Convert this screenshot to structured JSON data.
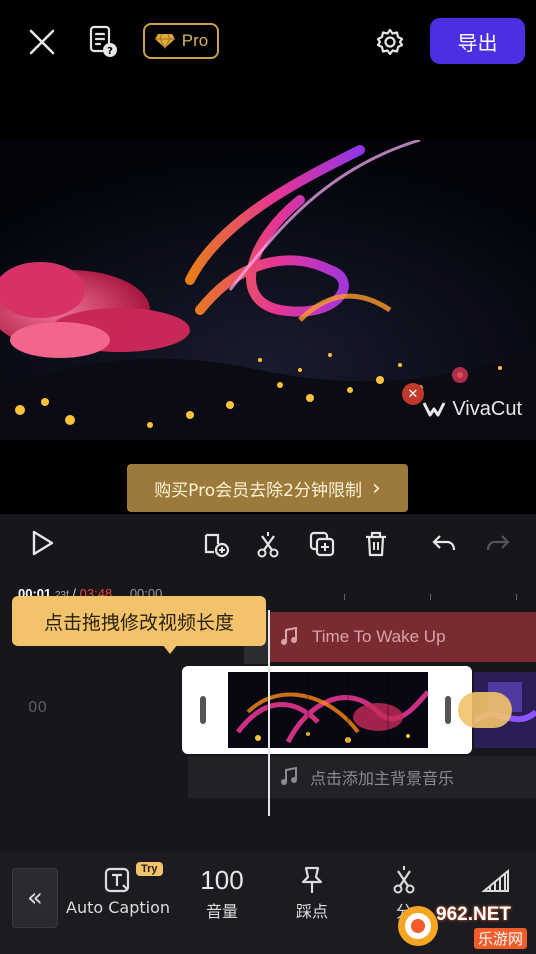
{
  "topbar": {
    "close_icon": "close-icon",
    "help_doc_icon": "help-document-icon",
    "pro_badge_label": "Pro",
    "settings_icon": "gear-icon",
    "export_label": "导出"
  },
  "preview": {
    "watermark_text": "VivaCut",
    "buy_banner_label": "购买Pro会员去除2分钟限制",
    "buy_banner_chevron": "›"
  },
  "toolbar": {
    "play_icon": "play-icon",
    "add_keyframe_icon": "add-clip-icon",
    "split_icon": "scissors-icon",
    "duplicate_icon": "duplicate-icon",
    "delete_icon": "trash-icon",
    "undo_icon": "undo-icon",
    "redo_icon": "redo-icon"
  },
  "timeline": {
    "current_time": "00:01",
    "current_frame": "23f",
    "separator": "/",
    "total_time": "03:48",
    "ruler_start": "00:00",
    "tooltip": "点击拖拽修改视频长度",
    "music_track_title": "Time To Wake Up",
    "left_time_label": "00",
    "add_music_label": "点击添加主背景音乐"
  },
  "bottombar": {
    "collapse_label": "«",
    "tools": [
      {
        "label": "Auto Caption",
        "icon": "auto-caption-icon",
        "badge": "Try"
      },
      {
        "label": "音量",
        "value": "100",
        "icon": "volume-value"
      },
      {
        "label": "踩点",
        "icon": "pin-icon"
      },
      {
        "label": "分",
        "icon": "split-icon"
      },
      {
        "label": "",
        "icon": "signal-icon"
      }
    ]
  },
  "site_watermark": {
    "number": "962.NET",
    "text": "乐游网"
  },
  "colors": {
    "accent": "#4b2fe0",
    "gold": "#c9a146",
    "tooltip": "#f2c36a",
    "music_track": "#7a2a31"
  }
}
